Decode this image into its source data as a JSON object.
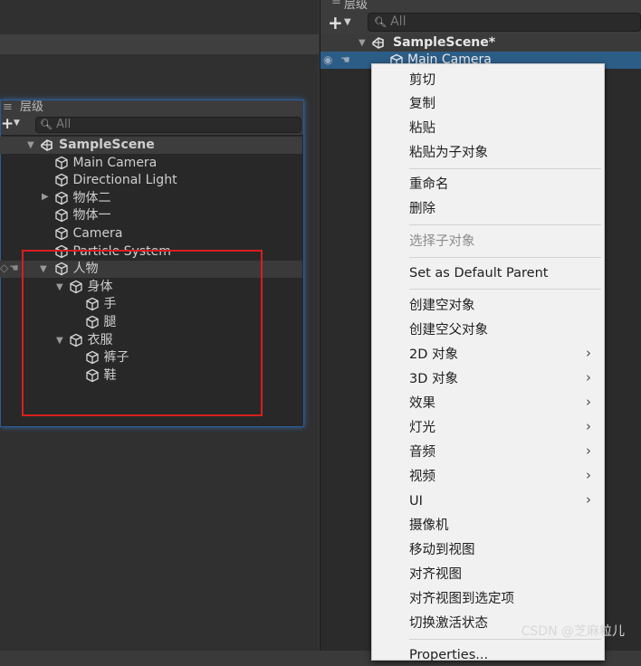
{
  "left_hierarchy": {
    "tab_title": "层级",
    "search_placeholder": "All",
    "scene": "SampleScene",
    "items": [
      {
        "label": "Main Camera"
      },
      {
        "label": "Directional Light"
      },
      {
        "label": "物体二"
      },
      {
        "label": "物体一"
      },
      {
        "label": "Camera"
      },
      {
        "label": "Particle System"
      },
      {
        "label": "人物"
      },
      {
        "label": "身体"
      },
      {
        "label": "手"
      },
      {
        "label": "腿"
      },
      {
        "label": "衣服"
      },
      {
        "label": "裤子"
      },
      {
        "label": "鞋"
      }
    ]
  },
  "right_hierarchy": {
    "tab_title": "层级",
    "search_placeholder": "All",
    "scene": "SampleScene*",
    "selected_item": "Main Camera"
  },
  "context_menu": {
    "items": [
      {
        "label": "剪切"
      },
      {
        "label": "复制"
      },
      {
        "label": "粘贴"
      },
      {
        "label": "粘贴为子对象"
      },
      {
        "label": "重命名"
      },
      {
        "label": "删除"
      },
      {
        "label": "选择子对象"
      },
      {
        "label": "Set as Default Parent"
      },
      {
        "label": "创建空对象"
      },
      {
        "label": "创建空父对象"
      },
      {
        "label": "2D 对象"
      },
      {
        "label": "3D 对象"
      },
      {
        "label": "效果"
      },
      {
        "label": "灯光"
      },
      {
        "label": "音频"
      },
      {
        "label": "视频"
      },
      {
        "label": "UI"
      },
      {
        "label": "摄像机"
      },
      {
        "label": "移动到视图"
      },
      {
        "label": "对齐视图"
      },
      {
        "label": "对齐视图到选定项"
      },
      {
        "label": "切换激活状态"
      },
      {
        "label": "Properties..."
      }
    ]
  },
  "watermark": "CSDN @芝麻粒儿"
}
